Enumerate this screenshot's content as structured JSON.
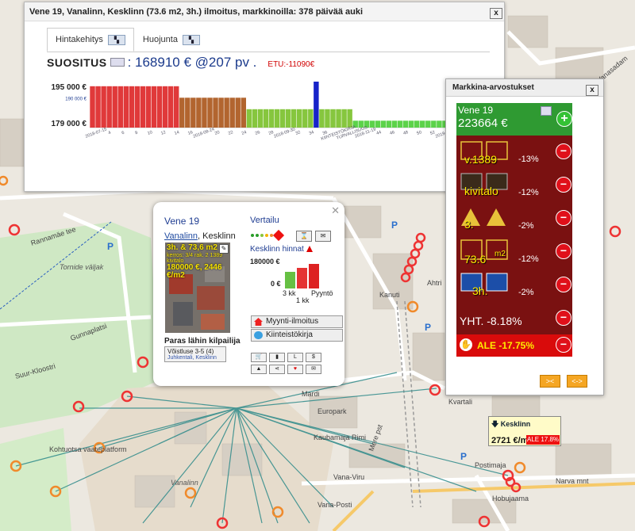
{
  "main_window": {
    "title": "Vene 19, Vanalinn, Kesklinn (73.6 m2, 3h.) ilmoitus, markkinoilla: 378 päivää auki",
    "close": "x",
    "tabs": [
      {
        "label": "Hintakehitys",
        "active": true
      },
      {
        "label": "Huojunta",
        "active": false
      }
    ],
    "summary_label": "SUOSITUS",
    "summary_value": ": 168910 € @207 pv .",
    "etu": "ETU:-11090€",
    "chart_data": {
      "type": "bar",
      "y_tick_labels": [
        "195 000 €",
        "190 000 €",
        "179 000 €"
      ],
      "x_tick_labels": [
        "2018-07-15",
        "4",
        "6",
        "8",
        "10",
        "12",
        "14",
        "16",
        "2018-08-24",
        "20",
        "22",
        "24",
        "26",
        "28",
        "2018-09-30",
        "32",
        "34",
        "36",
        "KIINTEISTÖKIRJA",
        "TURVALLISUUS",
        "2018-11-19",
        "44",
        "46",
        "48",
        "50",
        "52",
        "2019-02-15"
      ],
      "ylim": [
        177000,
        197000
      ],
      "values": [
        195000,
        195000,
        195000,
        195000,
        195000,
        195000,
        195000,
        195000,
        195000,
        195000,
        195000,
        195000,
        195000,
        195000,
        195000,
        195000,
        190000,
        190000,
        190000,
        190000,
        190000,
        190000,
        190000,
        190000,
        190000,
        190000,
        190000,
        190000,
        185000,
        185000,
        185000,
        185000,
        185000,
        185000,
        185000,
        185000,
        185000,
        185000,
        185000,
        185000,
        197000,
        185000,
        185000,
        185000,
        185000,
        185000,
        185000,
        180000,
        180000,
        180000,
        180000,
        180000,
        180000,
        180000,
        180000,
        180000,
        180000,
        180000,
        180000,
        180000,
        180000,
        180000,
        180000,
        180000,
        180000
      ],
      "highlight_index": 40,
      "colors": {
        "high": "#e0393a",
        "mid": "#b2652f",
        "low": "#86c63e",
        "lowest": "#5cd24a",
        "highlight": "#1723c9"
      }
    }
  },
  "popup": {
    "title": "Vene 19",
    "address_link": "Vanalinn",
    "address_rest": ", Kesklinn",
    "photo_line1": "3h. & 73,6 m2",
    "photo_line2": "kerros: 3/4 rak. 2 1389",
    "photo_line3": "kivitalo",
    "photo_line4": "180000 €, 2446 €/m2",
    "compare_title": "Vertailu",
    "prices_label": "Kesklinn hinnat",
    "mini_y_top": "180000 €",
    "mini_y_zero": "0 €",
    "mini_lbl_3kk": "3 kk",
    "mini_lbl_pyynto": "Pyyntö",
    "mini_lbl_1kk": "1 kk",
    "btn_myynti": "Myynti-ilmoitus",
    "btn_kiinteisto": "Kiinteistökirja",
    "paras": "Paras lähin kilpailija",
    "voitluse_l1": "Võistluse 3-5 (4)",
    "voitluse_l2": "Juhkentali, Kesklinn"
  },
  "market_window": {
    "title": "Markkina-arvostukset",
    "close": "x",
    "name": "Vene 19",
    "price": "223664 €",
    "rows": [
      {
        "label": "v.1389",
        "pct": "-13%"
      },
      {
        "label": "kivitalo",
        "pct": "-12%"
      },
      {
        "label": "3.",
        "pct": "-2%"
      },
      {
        "label": "73.6",
        "unit": "m2",
        "pct": "-12%"
      },
      {
        "label": "3h.",
        "pct": "-2%"
      }
    ],
    "total": "YHT. -8.18%",
    "ale": "ALE -17.75%",
    "nav_left": "><",
    "nav_right": "<->"
  },
  "kesklinn_badge": {
    "title": "Kesklinn",
    "value": "2721 €/m2",
    "ale": "ALE 17.8%"
  },
  "map_labels": {
    "torn": "Tornide väljak",
    "rannamae": "Rannamäe tee",
    "gunnaplat": "Gunnaplatsi",
    "suur_kloostri": "Suur-Kloostri",
    "vana_viru": "Vana-Viru",
    "narva": "Narva mnt",
    "hobujaama": "Hobujaama",
    "vanalinn": "Vanalinn",
    "kaubamaja": "Kaubamaja Rimi",
    "europark": "Europark",
    "vanasadam": "Vanasadam",
    "ahtri": "Ahtri",
    "tartu": "Kvartali",
    "kanuti": "Kanuti",
    "postimaja": "Postimaja",
    "kohtuo": "Kohtuotsa vaateplatform",
    "mere": "Mere pst",
    "mardi": "Mardi",
    "vana_posti": "Vana-Posti"
  }
}
